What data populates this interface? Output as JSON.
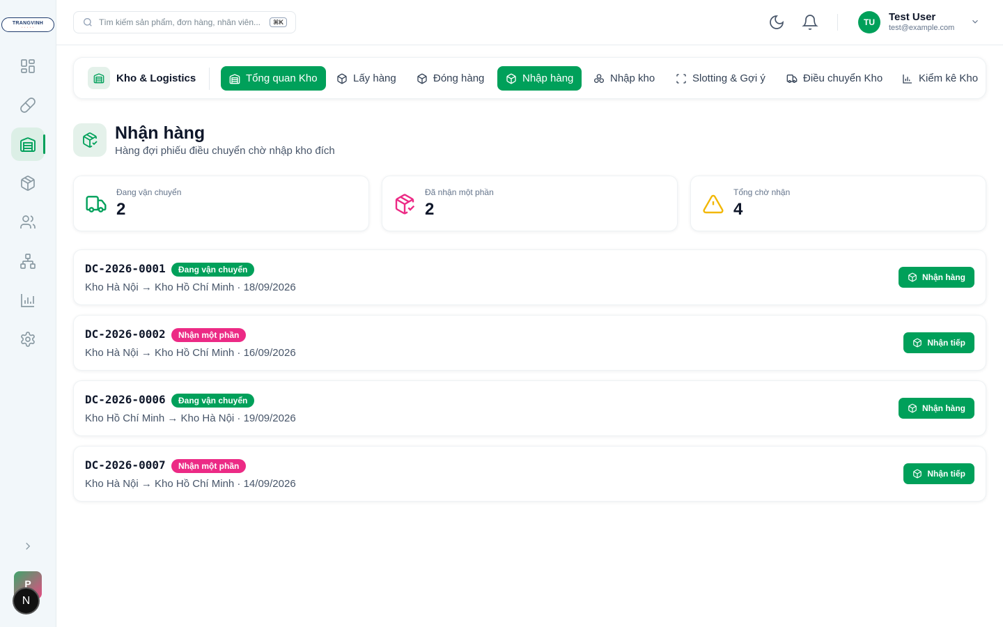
{
  "brand": {
    "logo_text": "TRANGVINH",
    "logo_sub": "• • • • •"
  },
  "sidebar": {
    "items": [
      {
        "icon": "grid-icon"
      },
      {
        "icon": "pill-icon"
      },
      {
        "icon": "warehouse-icon",
        "active": true
      },
      {
        "icon": "box-icon"
      },
      {
        "icon": "users-icon"
      },
      {
        "icon": "network-icon"
      },
      {
        "icon": "chart-icon"
      },
      {
        "icon": "gear-icon"
      }
    ],
    "avatar_p": "P",
    "avatar_n": "N"
  },
  "header": {
    "search_placeholder": "Tìm kiếm sản phẩm, đơn hàng, nhân viên...",
    "shortcut": "⌘K",
    "user": {
      "initials": "TU",
      "name": "Test User",
      "email": "test@example.com"
    }
  },
  "tabs": {
    "module": "Kho & Logistics",
    "items": [
      {
        "label": "Tổng quan Kho",
        "icon": "warehouse-icon",
        "active": true
      },
      {
        "label": "Lấy hàng",
        "icon": "box-icon",
        "active": false
      },
      {
        "label": "Đóng hàng",
        "icon": "box-icon",
        "active": false
      },
      {
        "label": "Nhập hàng",
        "icon": "box-icon",
        "active": true
      },
      {
        "label": "Nhập kho",
        "icon": "boxes-icon",
        "active": false
      },
      {
        "label": "Slotting & Gợi ý",
        "icon": "scan-icon",
        "active": false
      },
      {
        "label": "Điều chuyển Kho",
        "icon": "truck-icon",
        "active": false
      },
      {
        "label": "Kiểm kê Kho",
        "icon": "chart-icon",
        "active": false
      }
    ]
  },
  "page": {
    "title": "Nhận hàng",
    "subtitle": "Hàng đợi phiếu điều chuyển chờ nhập kho đích"
  },
  "stats": [
    {
      "label": "Đang vận chuyển",
      "value": "2",
      "icon": "truck-icon",
      "color": "#00a05a"
    },
    {
      "label": "Đã nhận một phần",
      "value": "2",
      "icon": "package-check-icon",
      "color": "#ec2a85"
    },
    {
      "label": "Tổng chờ nhận",
      "value": "4",
      "icon": "warning-icon",
      "color": "#f2b705"
    }
  ],
  "transfers": [
    {
      "code": "DC-2026-0001",
      "status": "Đang vận chuyển",
      "status_type": "transit",
      "route": "Kho Hà Nội → Kho Hồ Chí Minh · 18/09/2026",
      "action": "Nhận hàng"
    },
    {
      "code": "DC-2026-0002",
      "status": "Nhận một phần",
      "status_type": "partial",
      "route": "Kho Hà Nội → Kho Hồ Chí Minh · 16/09/2026",
      "action": "Nhận tiếp"
    },
    {
      "code": "DC-2026-0006",
      "status": "Đang vận chuyển",
      "status_type": "transit",
      "route": "Kho Hồ Chí Minh → Kho Hà Nội · 19/09/2026",
      "action": "Nhận hàng"
    },
    {
      "code": "DC-2026-0007",
      "status": "Nhận một phần",
      "status_type": "partial",
      "route": "Kho Hà Nội → Kho Hồ Chí Minh · 14/09/2026",
      "action": "Nhận tiếp"
    }
  ]
}
